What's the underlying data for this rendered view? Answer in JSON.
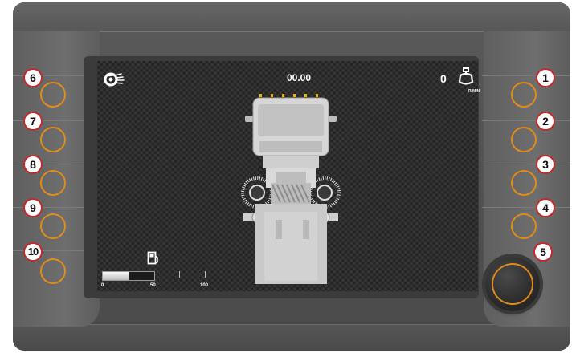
{
  "header": {
    "timer": "00.00",
    "rpm_value": "0",
    "rpm_unit": "R/MIN"
  },
  "fuel": {
    "level_percent": 50,
    "scale_labels": [
      "0",
      "50",
      "100"
    ]
  },
  "left_buttons": [
    {
      "number": "6",
      "icon": "button-ring"
    },
    {
      "number": "7",
      "icon": "button-ring"
    },
    {
      "number": "8",
      "icon": "button-ring"
    },
    {
      "number": "9",
      "icon": "button-ring"
    },
    {
      "number": "10",
      "icon": "button-ring"
    }
  ],
  "right_buttons": [
    {
      "number": "1",
      "icon": "button-ring"
    },
    {
      "number": "2",
      "icon": "button-ring"
    },
    {
      "number": "3",
      "icon": "button-ring"
    },
    {
      "number": "4",
      "icon": "button-ring"
    }
  ],
  "knob": {
    "number": "5"
  },
  "icons": {
    "top_left": "brush-washer-icon",
    "top_right": "engine-icon",
    "fuel": "fuel-pump-icon",
    "vehicle": "street-sweeper-truck-top-view"
  },
  "colors": {
    "accent_orange": "#e08b1a",
    "badge_border": "#c62828",
    "screen_bg": "#2d2d2d"
  }
}
